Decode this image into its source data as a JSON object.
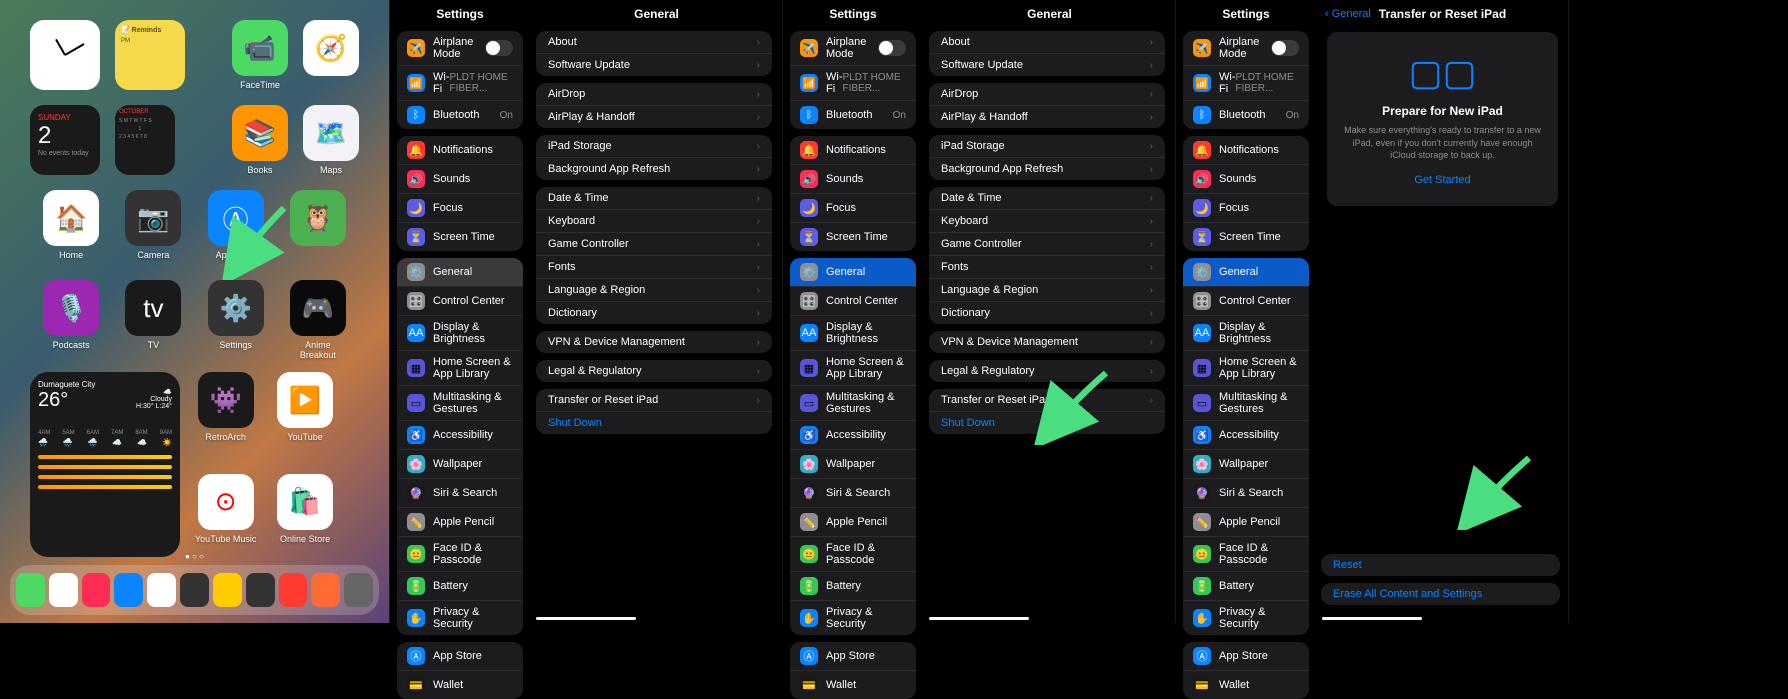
{
  "homescreen": {
    "notes_header": "Reminds",
    "cal_day": "SUNDAY",
    "cal_date": "2",
    "cal_sub": "No events today",
    "cal_month": "OCTOBER",
    "weather_city": "Dumaguete City",
    "weather_temp": "26°",
    "weather_cond": "Cloudy",
    "weather_range": "H:30° L:24°",
    "apps_row1": [
      "FaceTime",
      "",
      "Safari",
      "FaceTime",
      ""
    ],
    "apps": [
      {
        "name": "Books",
        "color": "#ff9500"
      },
      {
        "name": "Maps",
        "color": "#f2f2f7"
      },
      {
        "name": "Home",
        "color": "#fff"
      },
      {
        "name": "Camera",
        "color": "#333"
      },
      {
        "name": "App Store",
        "color": "#0a84ff"
      },
      {
        "name": "",
        "color": "#4caf50"
      },
      {
        "name": "Podcasts",
        "color": "#9c27b0"
      },
      {
        "name": "TV",
        "color": "#1a1a1a"
      },
      {
        "name": "Settings",
        "color": "#333"
      },
      {
        "name": "Anime Breakout",
        "color": "#0a0a0a"
      },
      {
        "name": "RetroArch",
        "color": "#1a1a1a"
      },
      {
        "name": "YouTube",
        "color": "#fff"
      },
      {
        "name": "YouTube Music",
        "color": "#fff"
      },
      {
        "name": "Online Store",
        "color": "#fff"
      }
    ]
  },
  "settings_title": "Settings",
  "general_title": "General",
  "transfer_title": "Transfer or Reset iPad",
  "back_general": "General",
  "sidebar": {
    "airplane": "Airplane Mode",
    "wifi": "Wi-Fi",
    "wifi_val": "PLDT HOME FIBER...",
    "bluetooth": "Bluetooth",
    "bt_val": "On",
    "notifications": "Notifications",
    "sounds": "Sounds",
    "focus": "Focus",
    "screentime": "Screen Time",
    "general": "General",
    "controlcenter": "Control Center",
    "display": "Display & Brightness",
    "homescreen": "Home Screen & App Library",
    "multitasking": "Multitasking & Gestures",
    "accessibility": "Accessibility",
    "wallpaper": "Wallpaper",
    "siri": "Siri & Search",
    "pencil": "Apple Pencil",
    "faceid": "Face ID & Passcode",
    "battery": "Battery",
    "privacy": "Privacy & Security",
    "appstore": "App Store",
    "wallet": "Wallet"
  },
  "general": {
    "about": "About",
    "software": "Software Update",
    "airdrop": "AirDrop",
    "airplay": "AirPlay & Handoff",
    "storage": "iPad Storage",
    "bgrefresh": "Background App Refresh",
    "datetime": "Date & Time",
    "keyboard": "Keyboard",
    "gamecontroller": "Game Controller",
    "fonts": "Fonts",
    "language": "Language & Region",
    "dictionary": "Dictionary",
    "vpn": "VPN & Device Management",
    "legal": "Legal & Regulatory",
    "transfer": "Transfer or Reset iPad",
    "shutdown": "Shut Down"
  },
  "transfer_page": {
    "prepare_title": "Prepare for New iPad",
    "prepare_desc": "Make sure everything's ready to transfer to a new iPad, even if you don't currently have enough iCloud storage to back up.",
    "get_started": "Get Started",
    "reset": "Reset",
    "erase": "Erase All Content and Settings"
  },
  "colors": {
    "orange": "#ff9500",
    "blue": "#0a84ff",
    "red": "#ff3b30",
    "pink": "#ff2d55",
    "purple": "#5e5ce6",
    "gray": "#8e8e93",
    "green": "#34c759",
    "indigo": "#5856d6",
    "teal": "#30b0c7"
  }
}
